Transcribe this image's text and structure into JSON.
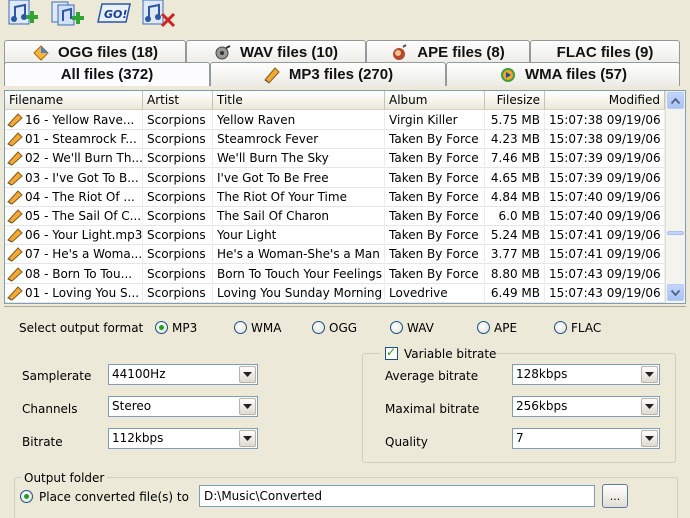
{
  "toolbar": {
    "buttons": [
      {
        "name": "add-files-button",
        "icon": "add-file-icon"
      },
      {
        "name": "add-folder-button",
        "icon": "add-folder-icon"
      },
      {
        "name": "convert-button",
        "icon": "go-icon",
        "label": "GO!"
      },
      {
        "name": "remove-files-button",
        "icon": "remove-file-icon"
      }
    ]
  },
  "tabs": {
    "row1": [
      {
        "id": "ogg",
        "label": "OGG files (18)",
        "icon": "ogg-icon"
      },
      {
        "id": "wav",
        "label": "WAV files (10)",
        "icon": "wav-icon"
      },
      {
        "id": "ape",
        "label": "APE files (8)",
        "icon": "ape-icon"
      },
      {
        "id": "flac",
        "label": "FLAC files (9)",
        "icon": "flac-icon"
      }
    ],
    "row2": [
      {
        "id": "all",
        "label": "All files (372)",
        "active": true
      },
      {
        "id": "mp3",
        "label": "MP3 files (270)",
        "icon": "mp3-icon"
      },
      {
        "id": "wma",
        "label": "WMA files (57)",
        "icon": "wma-icon"
      }
    ]
  },
  "filelist": {
    "columns": [
      "Filename",
      "Artist",
      "Title",
      "Album",
      "Filesize",
      "Modified"
    ],
    "rows": [
      [
        "16 - Yellow Rave...",
        "Scorpions",
        "Yellow Raven",
        "Virgin Killer",
        "5.75 MB",
        "15:07:38 09/19/06"
      ],
      [
        "01 - Steamrock F...",
        "Scorpions",
        "Steamrock Fever",
        "Taken By Force",
        "4.23 MB",
        "15:07:38 09/19/06"
      ],
      [
        "02 - We'll Burn Th...",
        "Scorpions",
        "We'll Burn The Sky",
        "Taken By Force",
        "7.46 MB",
        "15:07:39 09/19/06"
      ],
      [
        "03 - I've Got To B...",
        "Scorpions",
        "I've Got To Be Free",
        "Taken By Force",
        "4.65 MB",
        "15:07:39 09/19/06"
      ],
      [
        "04 - The Riot Of ...",
        "Scorpions",
        "The Riot Of Your Time",
        "Taken By Force",
        "4.84 MB",
        "15:07:40 09/19/06"
      ],
      [
        "05 - The Sail Of C...",
        "Scorpions",
        "The Sail Of Charon",
        "Taken By Force",
        "6.0 MB",
        "15:07:40 09/19/06"
      ],
      [
        "06 - Your Light.mp3",
        "Scorpions",
        "Your Light",
        "Taken By Force",
        "5.24 MB",
        "15:07:41 09/19/06"
      ],
      [
        "07 - He's a Woma...",
        "Scorpions",
        "He's a Woman-She's a Man",
        "Taken By Force",
        "3.77 MB",
        "15:07:41 09/19/06"
      ],
      [
        "08 - Born To Tou...",
        "Scorpions",
        "Born To Touch Your Feelings",
        "Taken By Force",
        "8.80 MB",
        "15:07:43 09/19/06"
      ],
      [
        "01 - Loving You S...",
        "Scorpions",
        "Loving You Sunday Morning",
        "Lovedrive",
        "6.49 MB",
        "15:07:43 09/19/06"
      ]
    ]
  },
  "settings": {
    "output_format_label": "Select output format",
    "formats": [
      {
        "label": "MP3",
        "selected": true
      },
      {
        "label": "WMA",
        "selected": false
      },
      {
        "label": "OGG",
        "selected": false
      },
      {
        "label": "WAV",
        "selected": false
      },
      {
        "label": "APE",
        "selected": false
      },
      {
        "label": "FLAC",
        "selected": false
      }
    ],
    "samplerate_label": "Samplerate",
    "samplerate_value": "44100Hz",
    "channels_label": "Channels",
    "channels_value": "Stereo",
    "bitrate_label": "Bitrate",
    "bitrate_value": "112kbps",
    "vbr_label": "Variable bitrate",
    "vbr_checked": true,
    "avg_bitrate_label": "Average bitrate",
    "avg_bitrate_value": "128kbps",
    "max_bitrate_label": "Maximal bitrate",
    "max_bitrate_value": "256kbps",
    "quality_label": "Quality",
    "quality_value": "7",
    "output_folder_label": "Output folder",
    "place_converted_label": "Place converted file(s) to",
    "output_path": "D:\\Music\\Converted",
    "browse_label": "..."
  },
  "colors": {
    "window_bg": "#ece9d8",
    "list_border": "#7f9db9",
    "radio_dot": "#21a121"
  }
}
